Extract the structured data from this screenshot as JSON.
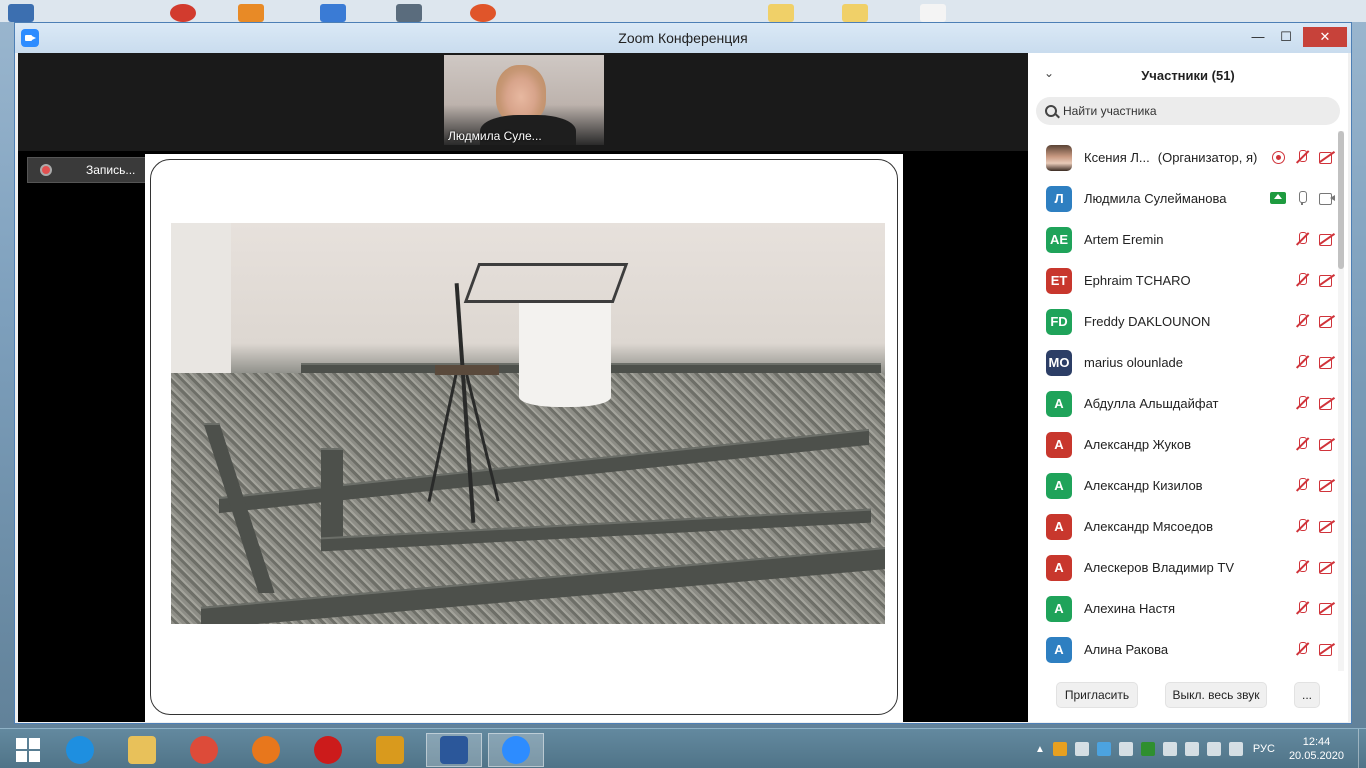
{
  "window": {
    "title": "Zoom Конференция",
    "minimize": "—",
    "maximize": "☐",
    "close": "✕"
  },
  "video": {
    "speaker_name": "Людмила Суле...",
    "recording_label": "Запись..."
  },
  "participants": {
    "title": "Участники (51)",
    "search_placeholder": "Найти участника",
    "list": [
      {
        "initials": "",
        "name": "Ксения Л...",
        "role": "(Организатор, я)",
        "color": "#ffffff",
        "photo": true,
        "state": "host"
      },
      {
        "initials": "Л",
        "name": "Людмила Сулейманова",
        "role": "",
        "color": "#2e7fc1",
        "photo": false,
        "state": "active"
      },
      {
        "initials": "AE",
        "name": "Artem Eremin",
        "role": "",
        "color": "#1fa35a",
        "photo": false,
        "state": "muted"
      },
      {
        "initials": "ET",
        "name": "Ephraim TCHARO",
        "role": "",
        "color": "#c8372d",
        "photo": false,
        "state": "muted"
      },
      {
        "initials": "FD",
        "name": "Freddy DAKLOUNON",
        "role": "",
        "color": "#1fa35a",
        "photo": false,
        "state": "muted"
      },
      {
        "initials": "MO",
        "name": "marius olounlade",
        "role": "",
        "color": "#2c3e66",
        "photo": false,
        "state": "muted"
      },
      {
        "initials": "A",
        "name": "Абдулла Альшдайфат",
        "role": "",
        "color": "#1fa35a",
        "photo": false,
        "state": "muted"
      },
      {
        "initials": "A",
        "name": "Александр Жуков",
        "role": "",
        "color": "#c8372d",
        "photo": false,
        "state": "muted"
      },
      {
        "initials": "A",
        "name": "Александр Кизилов",
        "role": "",
        "color": "#1fa35a",
        "photo": false,
        "state": "muted"
      },
      {
        "initials": "A",
        "name": "Александр Мясоедов",
        "role": "",
        "color": "#c8372d",
        "photo": false,
        "state": "muted"
      },
      {
        "initials": "A",
        "name": "Алескеров Владимир TV",
        "role": "",
        "color": "#c8372d",
        "photo": false,
        "state": "muted"
      },
      {
        "initials": "A",
        "name": "Алехина Настя",
        "role": "",
        "color": "#1fa35a",
        "photo": false,
        "state": "muted"
      },
      {
        "initials": "A",
        "name": "Алина Ракова",
        "role": "",
        "color": "#2e7fc1",
        "photo": false,
        "state": "muted"
      }
    ],
    "invite_label": "Пригласить",
    "mute_all_label": "Выкл. весь звук",
    "more_label": "..."
  },
  "taskbar": {
    "apps": [
      {
        "name": "start-button",
        "color": "#ffffff"
      },
      {
        "name": "internet-explorer-icon",
        "color": "#1e8fe0"
      },
      {
        "name": "file-explorer-icon",
        "color": "#e8c15a"
      },
      {
        "name": "chrome-icon",
        "color": "#dd4b39"
      },
      {
        "name": "firefox-icon",
        "color": "#e8771c"
      },
      {
        "name": "opera-icon",
        "color": "#cc1b1b"
      },
      {
        "name": "archive-icon",
        "color": "#d99a1d"
      },
      {
        "name": "word-icon",
        "color": "#2b579a"
      },
      {
        "name": "zoom-icon",
        "color": "#2d8cff"
      }
    ],
    "language": "РУС",
    "time": "12:44",
    "date": "20.05.2020"
  }
}
